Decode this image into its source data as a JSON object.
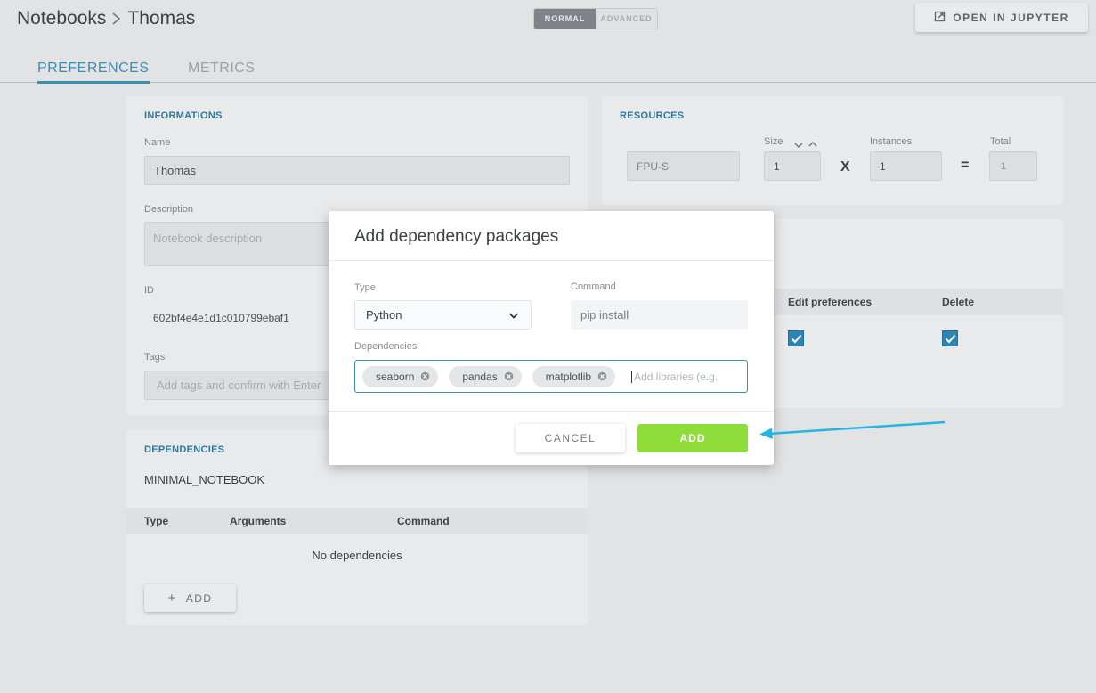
{
  "header": {
    "breadcrumb_root": "Notebooks",
    "breadcrumb_current": "Thomas",
    "mode_normal": "NORMAL",
    "mode_advanced": "ADVANCED",
    "open_jupyter": "OPEN IN JUPYTER"
  },
  "tabs": [
    {
      "label": "PREFERENCES",
      "active": true
    },
    {
      "label": "METRICS",
      "active": false
    }
  ],
  "informations": {
    "title": "INFORMATIONS",
    "name_label": "Name",
    "name_value": "Thomas",
    "description_label": "Description",
    "description_placeholder": "Notebook description",
    "id_label": "ID",
    "id_value": "602bf4e4e1d1c010799ebaf1",
    "tags_label": "Tags",
    "tags_placeholder": "Add tags and confirm with Enter"
  },
  "resources": {
    "title": "RESOURCES",
    "flavor": "FPU-S",
    "size_label": "Size",
    "size_value": "1",
    "times": "X",
    "instances_label": "Instances",
    "instances_value": "1",
    "equals": "=",
    "total_label": "Total",
    "total_value": "1"
  },
  "permissions": {
    "col_edit": "Edit preferences",
    "col_delete": "Delete",
    "edit_checked": true,
    "delete_checked": true
  },
  "dependencies": {
    "title": "DEPENDENCIES",
    "base": "MINIMAL_NOTEBOOK",
    "col_type": "Type",
    "col_arguments": "Arguments",
    "col_command": "Command",
    "empty": "No dependencies",
    "add_label": "ADD",
    "add_plus": "+"
  },
  "modal": {
    "title": "Add dependency packages",
    "type_label": "Type",
    "type_value": "Python",
    "command_label": "Command",
    "command_value": "pip install",
    "deps_label": "Dependencies",
    "packages": [
      "seaborn",
      "pandas",
      "matplotlib"
    ],
    "deps_placeholder": "Add libraries (e.g.",
    "cancel": "CANCEL",
    "add": "ADD"
  },
  "colors": {
    "accent": "#3c8fb0",
    "add_green": "#8fdd3a",
    "arrow": "#29b3e0"
  }
}
